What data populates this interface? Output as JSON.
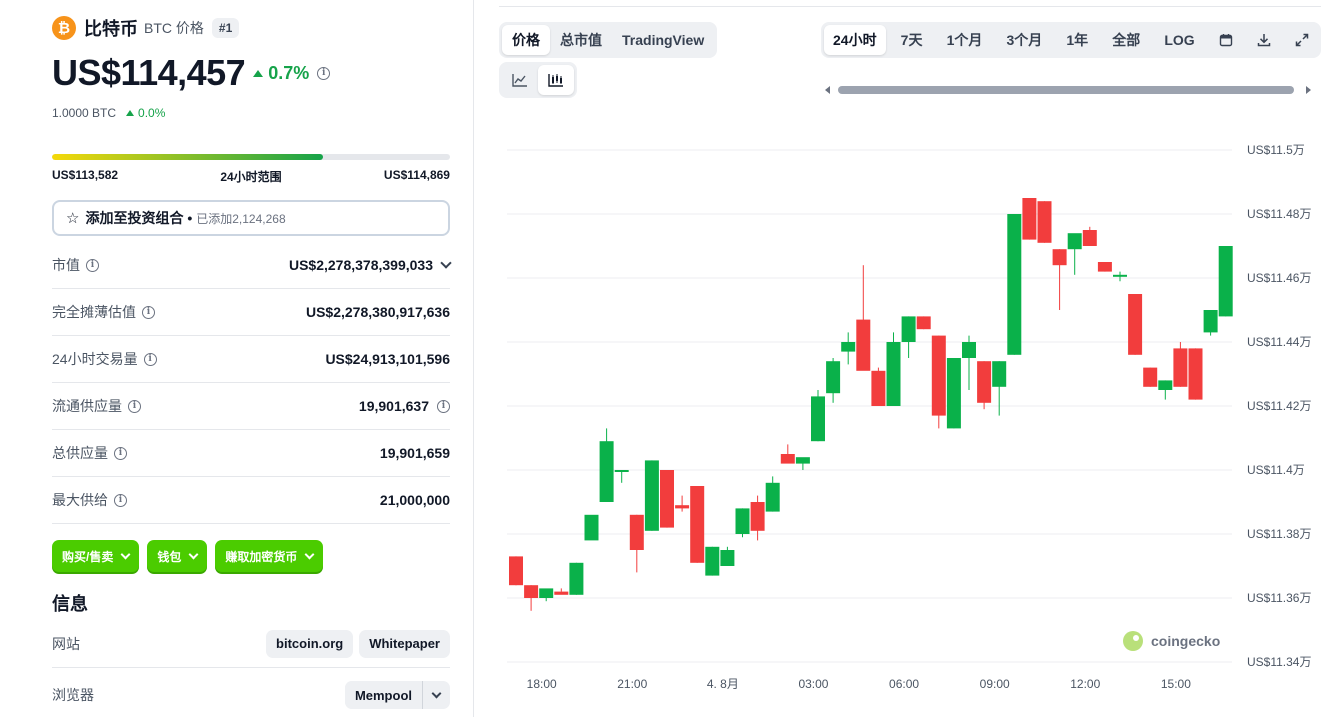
{
  "coin": {
    "logo_glyph": "₿",
    "name": "比特币",
    "subtitle": "BTC 价格",
    "rank": "#1",
    "price": "US$114,457",
    "change_pct": "0.7%",
    "btc_amount": "1.0000 BTC",
    "btc_change": "0.0%"
  },
  "range": {
    "low": "US$113,582",
    "label": "24小时范围",
    "high": "US$114,869",
    "fill_fraction": 0.68
  },
  "portfolio": {
    "label": "添加至投资组合 •",
    "added": "已添加2,124,268"
  },
  "stats": [
    {
      "label": "市值",
      "value": "US$2,278,378,399,033",
      "has_dropdown": true
    },
    {
      "label": "完全摊薄估值",
      "value": "US$2,278,380,917,636"
    },
    {
      "label": "24小时交易量",
      "value": "US$24,913,101,596"
    },
    {
      "label": "流通供应量",
      "value": "19,901,637",
      "has_info": true
    },
    {
      "label": "总供应量",
      "value": "19,901,659"
    },
    {
      "label": "最大供给",
      "value": "21,000,000"
    }
  ],
  "actions": {
    "buy_sell": "购买/售卖",
    "wallet": "钱包",
    "earn": "赚取加密货币"
  },
  "info": {
    "title": "信息",
    "website_label": "网站",
    "website_links": [
      "bitcoin.org",
      "Whitepaper"
    ],
    "explorer_label": "浏览器",
    "explorer_value": "Mempool"
  },
  "chart_tabs": {
    "price": "价格",
    "market_cap": "总市值",
    "tradingview": "TradingView"
  },
  "time_ranges": [
    "24小时",
    "7天",
    "1个月",
    "3个月",
    "1年",
    "全部",
    "LOG"
  ],
  "active_range": "24小时",
  "icons": {
    "line_chart": "line-chart-icon",
    "candle_chart": "candlestick-icon",
    "calendar": "calendar-icon",
    "download": "download-icon",
    "expand": "expand-icon"
  },
  "watermark": "coingecko",
  "colors": {
    "up": "#16a34a",
    "down": "#ef4444",
    "candle_up": "#0ab14a",
    "candle_down": "#f23d3d",
    "brand_green": "#4bcc00",
    "bitcoin_orange": "#f7931a"
  },
  "chart_data": {
    "type": "candlestick",
    "y_ticks": [
      "US$11.5万",
      "US$11.48万",
      "US$11.46万",
      "US$11.44万",
      "US$11.42万",
      "US$11.4万",
      "US$11.38万",
      "US$11.36万",
      "US$11.34万"
    ],
    "y_tick_values": [
      115000,
      114800,
      114600,
      114400,
      114200,
      114000,
      113800,
      113600,
      113400
    ],
    "ylim": [
      113400,
      115000
    ],
    "x_ticks": [
      "18:00",
      "21:00",
      "4. 8月",
      "03:00",
      "06:00",
      "09:00",
      "12:00",
      "15:00"
    ],
    "x_tick_index": [
      1.7,
      7.7,
      13.7,
      19.7,
      25.7,
      31.7,
      37.7,
      43.7
    ],
    "candles": [
      {
        "o": 113730,
        "h": 113730,
        "l": 113640,
        "c": 113640
      },
      {
        "o": 113640,
        "h": 113640,
        "l": 113560,
        "c": 113600
      },
      {
        "o": 113600,
        "h": 113600,
        "l": 113590,
        "c": 113630
      },
      {
        "o": 113620,
        "h": 113630,
        "l": 113620,
        "c": 113610
      },
      {
        "o": 113610,
        "h": 113710,
        "l": 113610,
        "c": 113710
      },
      {
        "o": 113780,
        "h": 113780,
        "l": 113780,
        "c": 113860
      },
      {
        "o": 113900,
        "h": 114130,
        "l": 113900,
        "c": 114090
      },
      {
        "o": 114000,
        "h": 114000,
        "l": 113960,
        "c": 114000
      },
      {
        "o": 113860,
        "h": 113860,
        "l": 113680,
        "c": 113750
      },
      {
        "o": 113810,
        "h": 114030,
        "l": 113810,
        "c": 114030
      },
      {
        "o": 114000,
        "h": 114000,
        "l": 113820,
        "c": 113820
      },
      {
        "o": 113890,
        "h": 113920,
        "l": 113870,
        "c": 113880
      },
      {
        "o": 113950,
        "h": 113950,
        "l": 113710,
        "c": 113710
      },
      {
        "o": 113670,
        "h": 113760,
        "l": 113670,
        "c": 113760
      },
      {
        "o": 113700,
        "h": 113760,
        "l": 113700,
        "c": 113750
      },
      {
        "o": 113800,
        "h": 113880,
        "l": 113790,
        "c": 113880
      },
      {
        "o": 113900,
        "h": 113920,
        "l": 113780,
        "c": 113810
      },
      {
        "o": 113870,
        "h": 113980,
        "l": 113870,
        "c": 113960
      },
      {
        "o": 114050,
        "h": 114080,
        "l": 114050,
        "c": 114020
      },
      {
        "o": 114020,
        "h": 114030,
        "l": 114000,
        "c": 114040
      },
      {
        "o": 114090,
        "h": 114250,
        "l": 114090,
        "c": 114230
      },
      {
        "o": 114240,
        "h": 114350,
        "l": 114210,
        "c": 114340
      },
      {
        "o": 114370,
        "h": 114430,
        "l": 114330,
        "c": 114400
      },
      {
        "o": 114470,
        "h": 114640,
        "l": 114370,
        "c": 114310
      },
      {
        "o": 114310,
        "h": 114320,
        "l": 114200,
        "c": 114200
      },
      {
        "o": 114200,
        "h": 114430,
        "l": 114200,
        "c": 114400
      },
      {
        "o": 114400,
        "h": 114480,
        "l": 114350,
        "c": 114480
      },
      {
        "o": 114480,
        "h": 114480,
        "l": 114440,
        "c": 114440
      },
      {
        "o": 114420,
        "h": 114420,
        "l": 114130,
        "c": 114170
      },
      {
        "o": 114130,
        "h": 114350,
        "l": 114130,
        "c": 114350
      },
      {
        "o": 114350,
        "h": 114420,
        "l": 114250,
        "c": 114400
      },
      {
        "o": 114340,
        "h": 114340,
        "l": 114190,
        "c": 114210
      },
      {
        "o": 114260,
        "h": 114340,
        "l": 114170,
        "c": 114340
      },
      {
        "o": 114360,
        "h": 114800,
        "l": 114360,
        "c": 114800
      },
      {
        "o": 114850,
        "h": 114850,
        "l": 114720,
        "c": 114720
      },
      {
        "o": 114840,
        "h": 114840,
        "l": 114710,
        "c": 114710
      },
      {
        "o": 114690,
        "h": 114690,
        "l": 114500,
        "c": 114640
      },
      {
        "o": 114690,
        "h": 114730,
        "l": 114610,
        "c": 114740
      },
      {
        "o": 114750,
        "h": 114760,
        "l": 114700,
        "c": 114700
      },
      {
        "o": 114650,
        "h": 114650,
        "l": 114620,
        "c": 114620
      },
      {
        "o": 114610,
        "h": 114620,
        "l": 114590,
        "c": 114610
      },
      {
        "o": 114550,
        "h": 114550,
        "l": 114360,
        "c": 114360
      },
      {
        "o": 114320,
        "h": 114320,
        "l": 114260,
        "c": 114260
      },
      {
        "o": 114250,
        "h": 114280,
        "l": 114220,
        "c": 114280
      },
      {
        "o": 114380,
        "h": 114400,
        "l": 114260,
        "c": 114260
      },
      {
        "o": 114380,
        "h": 114380,
        "l": 114220,
        "c": 114220
      },
      {
        "o": 114430,
        "h": 114500,
        "l": 114420,
        "c": 114500
      },
      {
        "o": 114480,
        "h": 114700,
        "l": 114480,
        "c": 114700
      }
    ]
  }
}
